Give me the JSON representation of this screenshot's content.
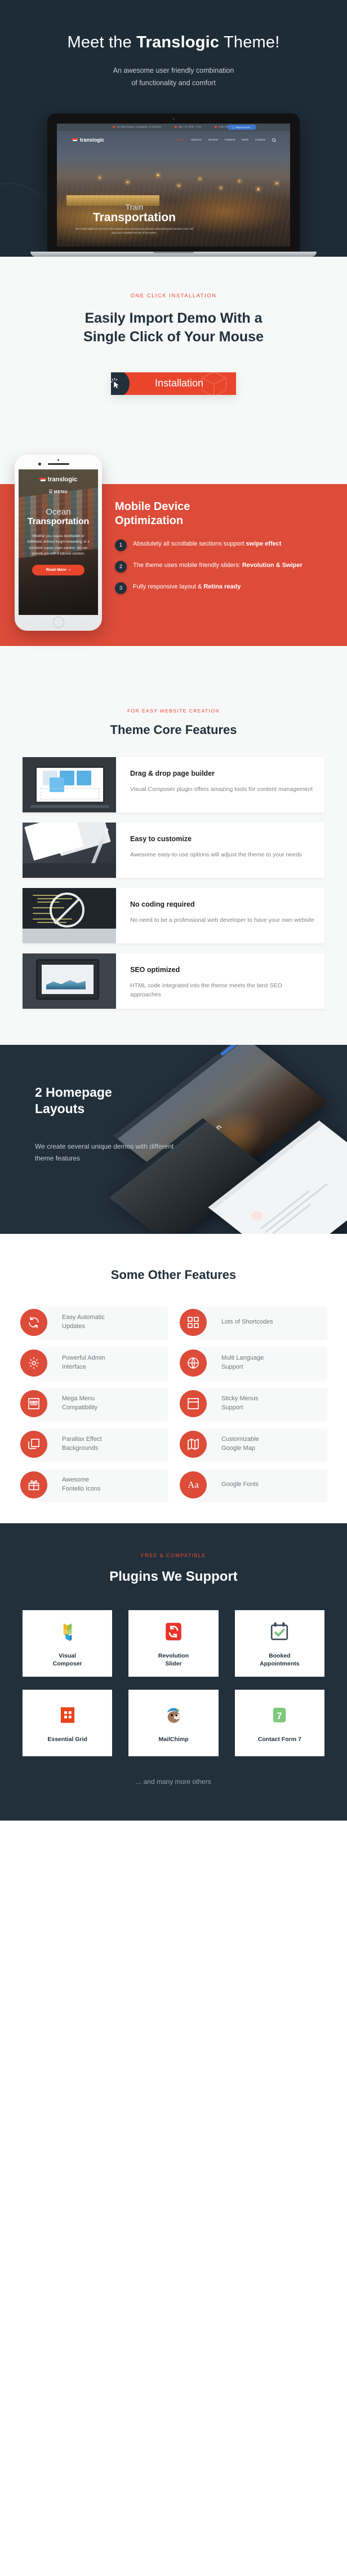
{
  "hero": {
    "title_pre": "Meet the ",
    "title_bold": "Translogic",
    "title_post": " Theme!",
    "subtitle_line1": "An awesome user friendly combination",
    "subtitle_line2": "of functionality and comfort",
    "laptop": {
      "topbar": {
        "address": "314 Street Avenue, Los Angeles, LA 2415 USA",
        "hours": "Mon - Fri, 09:00 - 17:00",
        "phone": "8 800 256 16 97",
        "quote_button": "Request Quote"
      },
      "logo": "translogic",
      "nav": [
        "Home",
        "About Us",
        "Services",
        "Features",
        "News",
        "Contacts"
      ],
      "active_nav": "Home",
      "slide_small": "Train",
      "slide_big": "Transportation",
      "slide_text": "But I must explain to you how all this mistaken idea of denouncing pleasure and praising pain was born and I will give you a complete account of the system."
    }
  },
  "install": {
    "eyebrow": "ONE CLICK INSTALLATION",
    "heading_line1": "Easily Import Demo With a",
    "heading_line2": "Single Click of Your Mouse",
    "button_label": "Installation",
    "accent": "#e8452c"
  },
  "mobile": {
    "title_line1": "Mobile Device",
    "title_line2": "Optimization",
    "panel_color": "#dd4b39",
    "items": [
      {
        "num": "1",
        "text": "Absolutely all scrollable sections support ",
        "bold": "swipe effect"
      },
      {
        "num": "2",
        "text": "The theme uses mobile friendly sliders: ",
        "bold": "Revolution & Swiper"
      },
      {
        "num": "3",
        "text": "Fully responsive layout & ",
        "bold": "Retina ready"
      }
    ],
    "phone": {
      "logo": "translogic",
      "menu_label": "MENU",
      "slide_small": "Ocean",
      "slide_big": "Transportation",
      "slide_text": "Whether you require distribution or fulfillment, defined freight forwarding, or a complete supply chain solution, we can provide you with a tailored solution.",
      "button_label": "Read More"
    }
  },
  "core": {
    "eyebrow": "FOR EASY WEBSITE CREATION",
    "heading": "Theme Core Features",
    "features": [
      {
        "title": "Drag & drop page builder",
        "desc": "Visual Composer plugin offers amazing tools for content management",
        "thumb": "drag-drop-builder-thumb"
      },
      {
        "title": "Easy to customize",
        "desc": "Awesome easy-to-use options will adjust the theme to your needs",
        "thumb": "customize-thumb"
      },
      {
        "title": "No coding required",
        "desc": "No need to be a professional web developer to have your own website",
        "thumb": "no-coding-thumb"
      },
      {
        "title": "SEO optimized",
        "desc": "HTML code integrated into the theme meets the best SEO approaches",
        "thumb": "seo-thumb"
      }
    ]
  },
  "homepage_layouts": {
    "title_line1": "2 Homepage",
    "title_line2": "Layouts",
    "paragraph": "We create several unique demos with different theme features",
    "bg": "#22303c"
  },
  "other_features": {
    "heading": "Some Other Features",
    "badge_color": "#dd4b39",
    "items": [
      {
        "label_line1": "Easy Automatic",
        "label_line2": "Updates",
        "icon": "refresh-icon"
      },
      {
        "label_line1": "Lots of Shortcodes",
        "label_line2": "",
        "icon": "grid-blocks-icon"
      },
      {
        "label_line1": "Powerful Admin",
        "label_line2": "Interface",
        "icon": "gear-icon"
      },
      {
        "label_line1": "Multi Language",
        "label_line2": "Support",
        "icon": "globe-icon"
      },
      {
        "label_line1": "Mega Menu",
        "label_line2": "Compatibility",
        "icon": "mega-menu-icon"
      },
      {
        "label_line1": "Sticky Menus",
        "label_line2": "Support",
        "icon": "sticky-menu-icon"
      },
      {
        "label_line1": "Parallax Effect",
        "label_line2": "Backgrounds",
        "icon": "layers-icon"
      },
      {
        "label_line1": "Customizable",
        "label_line2": "Google Map",
        "icon": "map-icon"
      },
      {
        "label_line1": "Awesome",
        "label_line2": "Fontello Icons",
        "icon": "gift-icon"
      },
      {
        "label_line1": "Google Fonts",
        "label_line2": "",
        "icon": "typography-aa-icon"
      }
    ]
  },
  "plugins": {
    "eyebrow": "FREE & COMPATIBLE",
    "heading": "Plugins We Support",
    "items": [
      {
        "name_line1": "Visual",
        "name_line2": "Composer",
        "icon": "visual-composer-logo"
      },
      {
        "name_line1": "Revolution",
        "name_line2": "Slider",
        "icon": "revolution-slider-logo"
      },
      {
        "name_line1": "Booked",
        "name_line2": "Appointments",
        "icon": "booked-appointments-logo"
      },
      {
        "name_line1": "Essential Grid",
        "name_line2": "",
        "icon": "essential-grid-logo"
      },
      {
        "name_line1": "MailChimp",
        "name_line2": "",
        "icon": "mailchimp-logo"
      },
      {
        "name_line1": "Contact Form 7",
        "name_line2": "",
        "icon": "contact-form-7-logo"
      }
    ],
    "more_text": "... and many more others"
  }
}
